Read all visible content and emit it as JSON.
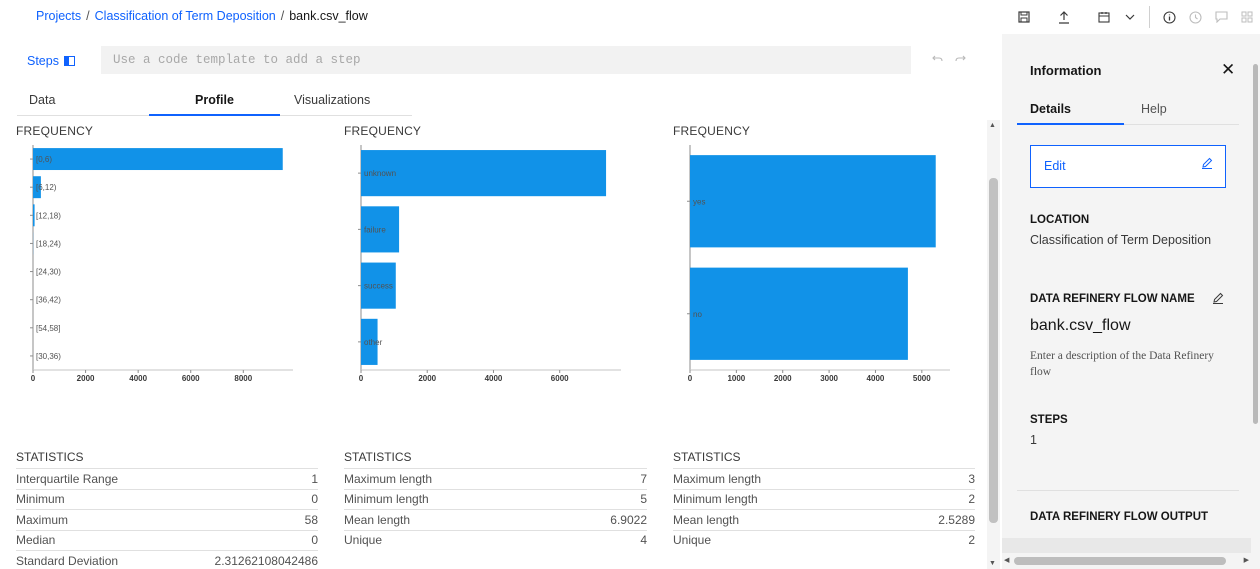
{
  "breadcrumb": {
    "projects": "Projects",
    "project": "Classification of Term Deposition",
    "current": "bank.csv_flow",
    "separator": "/"
  },
  "toolbar": {
    "icons": [
      "save-icon",
      "export-icon",
      "schedule-icon",
      "chevron-down-icon",
      "info-icon",
      "history-icon",
      "comment-icon",
      "grid-icon"
    ]
  },
  "steps": {
    "label": "Steps",
    "placeholder": "Use a code template to add a step"
  },
  "tabs": [
    {
      "label": "Data"
    },
    {
      "label": "Profile",
      "active": true
    },
    {
      "label": "Visualizations"
    }
  ],
  "charts": [
    {
      "title": "FREQUENCY"
    },
    {
      "title": "FREQUENCY"
    },
    {
      "title": "FREQUENCY"
    }
  ],
  "chart_data": [
    {
      "type": "bar",
      "orientation": "horizontal",
      "title": "FREQUENCY",
      "categories": [
        "[0,6)",
        "[6,12)",
        "[12,18)",
        "[18,24)",
        "[24,30)",
        "[36,42)",
        "[54,58]",
        "[30,36)"
      ],
      "values": [
        9500,
        300,
        60,
        5,
        0,
        0,
        0,
        0
      ],
      "xticks": [
        "0",
        "2000",
        "4000",
        "6000",
        "8000"
      ],
      "xlim": [
        0,
        9700
      ],
      "color": "#1192e8"
    },
    {
      "type": "bar",
      "orientation": "horizontal",
      "title": "FREQUENCY",
      "categories": [
        "unknown",
        "failure",
        "success",
        "other"
      ],
      "values": [
        7400,
        1150,
        1050,
        500
      ],
      "xticks": [
        "0",
        "2000",
        "4000",
        "6000"
      ],
      "xlim": [
        0,
        7700
      ],
      "color": "#1192e8"
    },
    {
      "type": "bar",
      "orientation": "horizontal",
      "title": "FREQUENCY",
      "categories": [
        "yes",
        "no"
      ],
      "values": [
        5300,
        4700
      ],
      "xticks": [
        "0",
        "1000",
        "2000",
        "3000",
        "4000",
        "5000"
      ],
      "xlim": [
        0,
        5500
      ],
      "color": "#1192e8"
    }
  ],
  "statistics": [
    {
      "title": "STATISTICS",
      "rows": [
        {
          "label": "Interquartile Range",
          "value": "1"
        },
        {
          "label": "Minimum",
          "value": "0"
        },
        {
          "label": "Maximum",
          "value": "58"
        },
        {
          "label": "Median",
          "value": "0"
        },
        {
          "label": "Standard Deviation",
          "value": "2.31262108042486"
        }
      ]
    },
    {
      "title": "STATISTICS",
      "rows": [
        {
          "label": "Maximum length",
          "value": "7"
        },
        {
          "label": "Minimum length",
          "value": "5"
        },
        {
          "label": "Mean length",
          "value": "6.9022"
        },
        {
          "label": "Unique",
          "value": "4"
        }
      ]
    },
    {
      "title": "STATISTICS",
      "rows": [
        {
          "label": "Maximum length",
          "value": "3"
        },
        {
          "label": "Minimum length",
          "value": "2"
        },
        {
          "label": "Mean length",
          "value": "2.5289"
        },
        {
          "label": "Unique",
          "value": "2"
        }
      ]
    }
  ],
  "panel": {
    "title": "Information",
    "tabs": [
      {
        "label": "Details"
      },
      {
        "label": "Help"
      }
    ],
    "edit_label": "Edit",
    "location_heading": "LOCATION",
    "location_value": "Classification of Term Deposition",
    "flow_name_heading": "DATA REFINERY FLOW NAME",
    "flow_name": "bank.csv_flow",
    "description_placeholder": "Enter a description of the Data Refinery flow",
    "steps_heading": "STEPS",
    "steps_count": "1",
    "output_heading": "DATA REFINERY FLOW OUTPUT"
  },
  "colors": {
    "accent": "#0f62fe",
    "bar": "#1192e8",
    "panel_bg": "#f4f4f4"
  }
}
